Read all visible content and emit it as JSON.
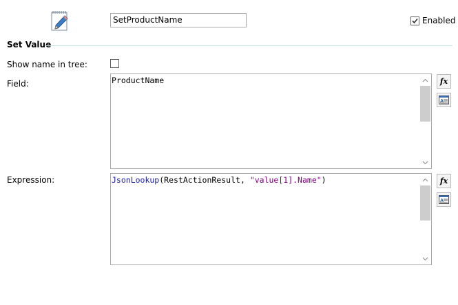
{
  "header": {
    "action_name": "SetProductName",
    "enabled_label": "Enabled",
    "enabled_checked": true,
    "action_icon": "pencil-notepad-icon"
  },
  "section": {
    "title": "Set Value"
  },
  "fields": {
    "show_name_label": "Show name in tree:",
    "show_name_checked": false,
    "field_label": "Field:",
    "field_value": "ProductName",
    "expression_label": "Expression:",
    "expression_tokens": {
      "fn": "JsonLookup",
      "open": "(RestActionResult, ",
      "str": "\"value[1].Name\"",
      "close": ")"
    }
  },
  "buttons": {
    "formula_icon": "fx-icon",
    "formula_label": "fx",
    "editor_icon": "text-editor-icon"
  }
}
